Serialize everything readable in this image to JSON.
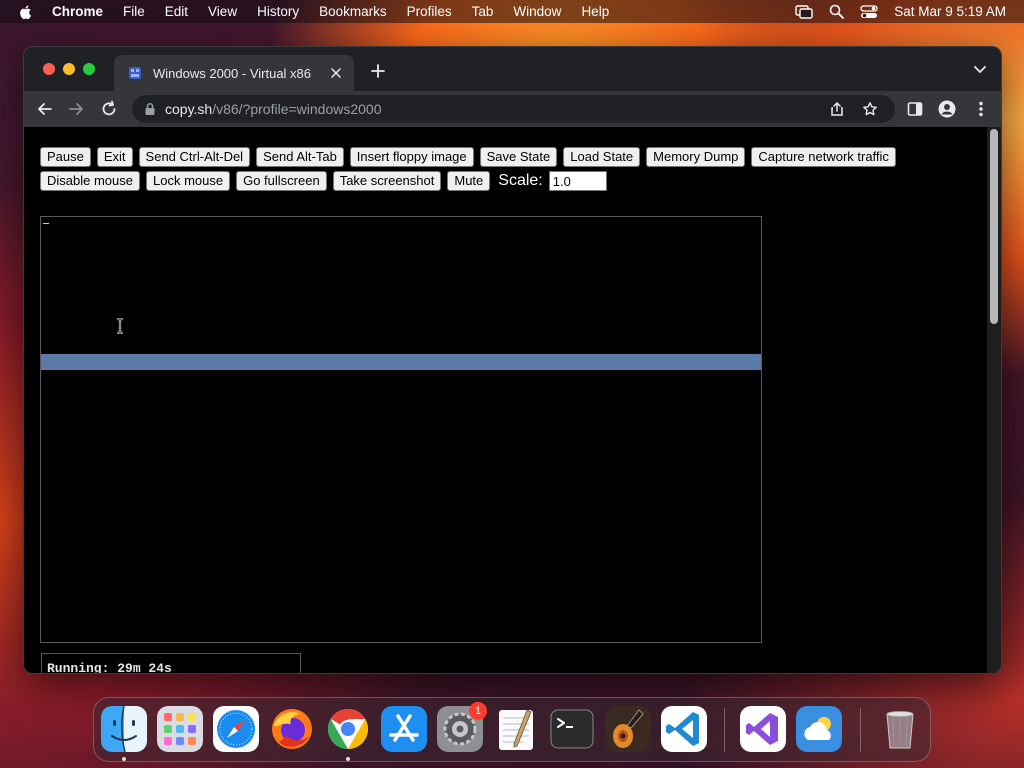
{
  "menubar": {
    "items": [
      "Chrome",
      "File",
      "Edit",
      "View",
      "History",
      "Bookmarks",
      "Profiles",
      "Tab",
      "Window",
      "Help"
    ],
    "datetime": "Sat Mar 9  5:19 AM"
  },
  "browser": {
    "tab_title": "Windows 2000 - Virtual x86",
    "url_host": "copy.sh",
    "url_path": "/v86/?profile=windows2000"
  },
  "controls": {
    "row1": [
      "Pause",
      "Exit",
      "Send Ctrl-Alt-Del",
      "Send Alt-Tab",
      "Insert floppy image",
      "Save State",
      "Load State",
      "Memory Dump",
      "Capture network traffic"
    ],
    "row2": [
      "Disable mouse",
      "Lock mouse",
      "Go fullscreen",
      "Take screenshot",
      "Mute"
    ],
    "scale_label": "Scale:",
    "scale_value": "1.0"
  },
  "status": {
    "running": "Running: 29m 24s"
  },
  "dock": {
    "apps": [
      "finder-icon",
      "launchpad-icon",
      "safari-icon",
      "firefox-icon",
      "chrome-icon",
      "app-store-icon",
      "system-preferences-icon",
      "textedit-icon",
      "terminal-icon",
      "garageband-icon",
      "vscode-icon",
      "visual-studio-icon",
      "weather-icon",
      "trash-icon"
    ],
    "system_preferences_badge": "1"
  },
  "colors": {
    "accent_bar": "#5a7aa8",
    "window_bg": "#202124"
  }
}
